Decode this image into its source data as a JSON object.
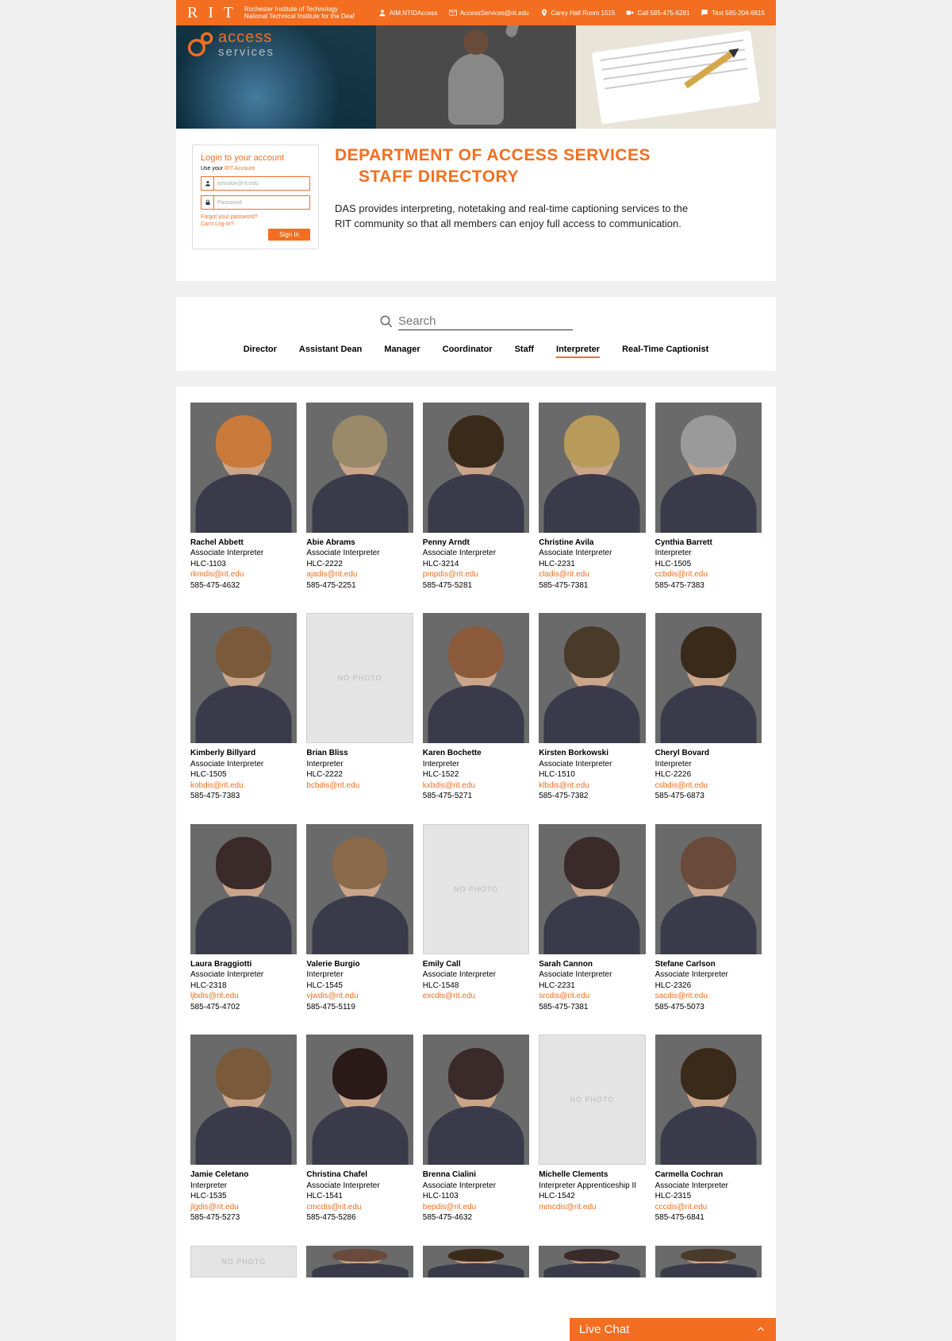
{
  "topbar": {
    "rit": "R I T",
    "sub1": "Rochester Institute of Technology",
    "sub2": "National Technical Institute for the Deaf",
    "links": {
      "aim": "AIM:NTIDAccess",
      "email": "AccessServices@rit.edu",
      "location": "Carey Hall Room 1515",
      "call": "Call 585-475-6281",
      "text": "Text 585-204-6815"
    }
  },
  "hero": {
    "logo_line1": "access",
    "logo_line2": "services"
  },
  "login": {
    "title": "Login to your account",
    "sub_prefix": "Use your ",
    "sub_link": "RIT Account",
    "username_placeholder": "johndoe@rit.edu",
    "password_placeholder": "Password",
    "forgot": "Forgot your password?",
    "cant": "Can't Log In?",
    "signin": "Sign In"
  },
  "intro": {
    "title_line1": "DEPARTMENT OF ACCESS SERVICES",
    "title_line2": "STAFF DIRECTORY",
    "para": "DAS provides interpreting, notetaking and real-time captioning services to the RIT community so that all members can enjoy full access to communication."
  },
  "search": {
    "placeholder": "Search"
  },
  "tabs": {
    "t0": "Director",
    "t1": "Assistant Dean",
    "t2": "Manager",
    "t3": "Coordinator",
    "t4": "Staff",
    "t5": "Interpreter",
    "t6": "Real-Time Captionist"
  },
  "nophoto_label": "NO PHOTO",
  "staff": [
    {
      "name": "Rachel Abbett",
      "title": "Associate Interpreter",
      "room": "HLC-1103",
      "email": "rkmdis@rit.edu",
      "phone": "585-475-4632",
      "hair": "#c97a3a"
    },
    {
      "name": "Abie Abrams",
      "title": "Associate Interpreter",
      "room": "HLC-2222",
      "email": "ajadis@rit.edu",
      "phone": "585-475-2251",
      "hair": "#9a8a6a"
    },
    {
      "name": "Penny Arndt",
      "title": "Associate Interpreter",
      "room": "HLC-3214",
      "email": "pmpdis@rit.edu",
      "phone": "585-475-5281",
      "hair": "#3a2a1a"
    },
    {
      "name": "Christine Avila",
      "title": "Associate Interpreter",
      "room": "HLC-2231",
      "email": "cladis@rit.edu",
      "phone": "585-475-7381",
      "hair": "#b89a5a"
    },
    {
      "name": "Cynthia Barrett",
      "title": "Interpreter",
      "room": "HLC-1505",
      "email": "ccbdis@rit.edu",
      "phone": "585-475-7383",
      "hair": "#9a9a9a"
    },
    {
      "name": "Kimberly Billyard",
      "title": "Associate Interpreter",
      "room": "HLC-1505",
      "email": "kobdis@rit.edu",
      "phone": "585-475-7383",
      "hair": "#7a5a3a"
    },
    {
      "name": "Brian Bliss",
      "title": "Interpreter",
      "room": "HLC-2222",
      "email": "bcbdis@rit.edu",
      "phone": "",
      "nophoto": true
    },
    {
      "name": "Karen Bochette",
      "title": "Interpreter",
      "room": "HLC-1522",
      "email": "kxbdis@rit.edu",
      "phone": "585-475-5271",
      "hair": "#8a5a3a"
    },
    {
      "name": "Kirsten Borkowski",
      "title": "Associate Interpreter",
      "room": "HLC-1510",
      "email": "klbdis@rit.edu",
      "phone": "585-475-7382",
      "hair": "#4a3a2a"
    },
    {
      "name": "Cheryl Bovard",
      "title": "Interpreter",
      "room": "HLC-2226",
      "email": "csbdis@rit.edu",
      "phone": "585-475-6873",
      "hair": "#3a2a1a"
    },
    {
      "name": "Laura Braggiotti",
      "title": "Associate Interpreter",
      "room": "HLC-2318",
      "email": "ljbdis@rit.edu",
      "phone": "585-475-4702",
      "hair": "#3a2a2a"
    },
    {
      "name": "Valerie Burgio",
      "title": "Interpreter",
      "room": "HLC-1545",
      "email": "vjwdis@rit.edu",
      "phone": "585-475-5119",
      "hair": "#8a6a4a"
    },
    {
      "name": "Emily Call",
      "title": "Associate Interpreter",
      "room": "HLC-1548",
      "email": "excdis@rit.edu",
      "phone": "",
      "nophoto": true
    },
    {
      "name": "Sarah Cannon",
      "title": "Associate Interpreter",
      "room": "HLC-2231",
      "email": "srcdis@rit.edu",
      "phone": "585-475-7381",
      "hair": "#3a2a2a"
    },
    {
      "name": "Stefane Carlson",
      "title": "Associate Interpreter",
      "room": "HLC-2326",
      "email": "sacdis@rit.edu",
      "phone": "585-475-5073",
      "hair": "#6a4a3a"
    },
    {
      "name": "Jamie Celetano",
      "title": "Interpreter",
      "room": "HLC-1535",
      "email": "jlgdis@rit.edu",
      "phone": "585-475-5273",
      "hair": "#7a5a3a"
    },
    {
      "name": "Christina Chafel",
      "title": "Associate Interpreter",
      "room": "HLC-1541",
      "email": "cmcdis@rit.edu",
      "phone": "585-475-5286",
      "hair": "#2a1a1a"
    },
    {
      "name": "Brenna Cialini",
      "title": "Associate Interpreter",
      "room": "HLC-1103",
      "email": "bepdis@rit.edu",
      "phone": "585-475-4632",
      "hair": "#3a2a2a"
    },
    {
      "name": "Michelle Clements",
      "title": "Interpreter Apprenticeship II",
      "room": "HLC-1542",
      "email": "mmcdis@rit.edu",
      "phone": "",
      "nophoto": true
    },
    {
      "name": "Carmella Cochran",
      "title": "Associate Interpreter",
      "room": "HLC-2315",
      "email": "cccdis@rit.edu",
      "phone": "585-475-6841",
      "hair": "#3a2a1a"
    },
    {
      "name": "",
      "title": "",
      "room": "",
      "email": "",
      "phone": "",
      "nophoto": true,
      "partial": true
    },
    {
      "name": "",
      "title": "",
      "room": "",
      "email": "",
      "phone": "",
      "hair": "#6a4a3a",
      "partial": true
    },
    {
      "name": "",
      "title": "",
      "room": "",
      "email": "",
      "phone": "",
      "hair": "#3a2a1a",
      "partial": true
    },
    {
      "name": "",
      "title": "",
      "room": "",
      "email": "",
      "phone": "",
      "hair": "#3a2a2a",
      "partial": true
    },
    {
      "name": "",
      "title": "",
      "room": "",
      "email": "",
      "phone": "",
      "hair": "#4a3a2a",
      "partial": true
    }
  ],
  "livechat": {
    "label": "Live Chat"
  }
}
